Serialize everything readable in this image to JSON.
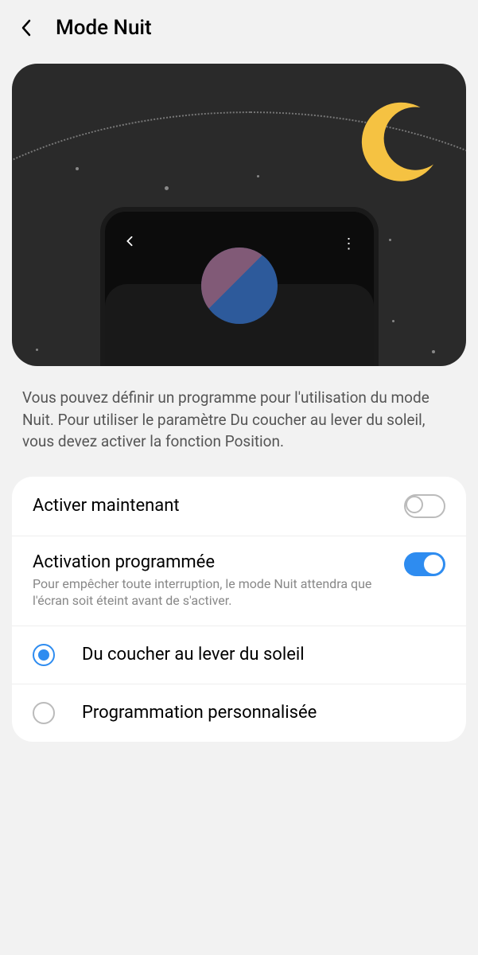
{
  "header": {
    "title": "Mode Nuit"
  },
  "description": "Vous pouvez définir un programme pour l'utilisation du mode Nuit. Pour utiliser le paramètre Du coucher au lever du soleil, vous devez activer la fonction Position.",
  "settings": {
    "activate_now": {
      "label": "Activer maintenant",
      "value": false
    },
    "scheduled": {
      "label": "Activation programmée",
      "sub": "Pour empêcher toute interruption, le mode Nuit attendra que l'écran soit éteint avant de s'activer.",
      "value": true
    },
    "options": [
      {
        "label": "Du coucher au lever du soleil",
        "selected": true
      },
      {
        "label": "Programmation personnalisée",
        "selected": false
      }
    ]
  }
}
